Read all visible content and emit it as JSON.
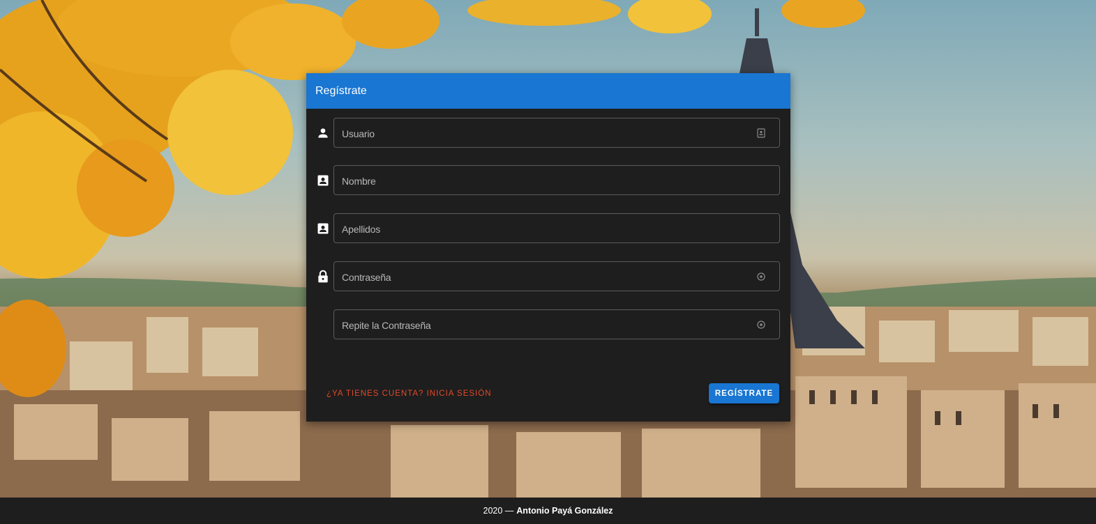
{
  "form": {
    "title": "Regístrate",
    "fields": [
      {
        "placeholder": "Usuario",
        "icon": "person-icon",
        "trailing_icon": "contact-card-icon"
      },
      {
        "placeholder": "Nombre",
        "icon": "account-box-icon"
      },
      {
        "placeholder": "Apellidos",
        "icon": "account-box-icon"
      },
      {
        "placeholder": "Contraseña",
        "icon": "lock-icon",
        "trailing_icon": "eye-icon"
      },
      {
        "placeholder": "Repite la Contraseña",
        "trailing_icon": "eye-icon"
      }
    ],
    "login_link": "¿Ya tienes cuenta? Inicia sesión",
    "submit_label": "Regístrate"
  },
  "footer": {
    "year": "2020 —",
    "author": "Antonio Payá González"
  },
  "colors": {
    "primary": "#1976d2",
    "card_bg": "#1e1e1e",
    "link": "#e04a2a"
  }
}
